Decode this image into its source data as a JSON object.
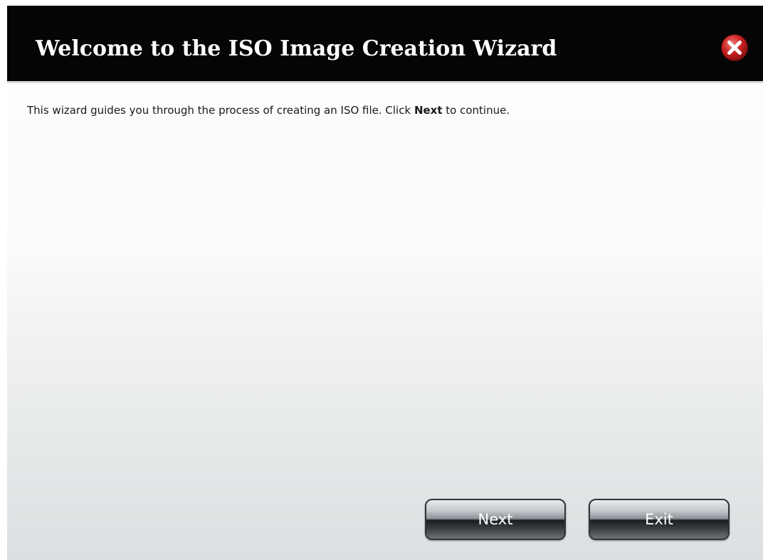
{
  "dialog": {
    "title": "Welcome to the ISO Image Creation Wizard",
    "close_icon": "close-icon",
    "message": {
      "before": "This wizard guides you through the process of creating an ISO file. Click ",
      "bold": "Next",
      "after": " to continue."
    },
    "buttons": {
      "next_label": "Next",
      "exit_label": "Exit"
    }
  },
  "colors": {
    "titlebar_bg": "#050505",
    "close_icon_red": "#cc2222",
    "button_dark": "#1b1e20"
  }
}
